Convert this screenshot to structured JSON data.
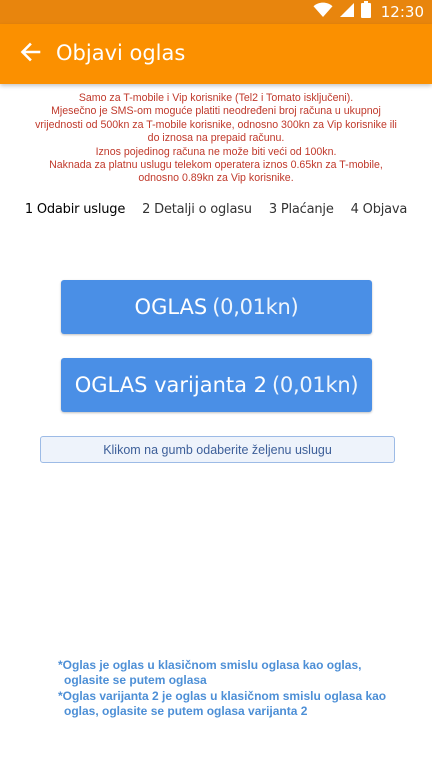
{
  "status_bar": {
    "time": "12:30",
    "icons": [
      "wifi-icon",
      "signal-icon",
      "battery-icon"
    ]
  },
  "app_bar": {
    "title": "Objavi oglas",
    "back_icon": "arrow-left-icon"
  },
  "notice": {
    "line1": "Samo za T-mobile i Vip korisnike (Tel2 i Tomato isključeni).",
    "line2": "Mjesečno je SMS-om moguće platiti neodređeni broj računa u ukupnoj vrijednosti od 500kn za T-mobile korisnike, odnosno 300kn za Vip korisnike ili do iznosa na prepaid računu.",
    "line3": "Iznos pojedinog računa ne može biti veći od 100kn.",
    "line4": "Naknada za platnu uslugu telekom operatera iznos 0.65kn za T-mobile, odnosno 0.89kn za Vip korisnike."
  },
  "steps": [
    {
      "label": "1 Odabir usluge"
    },
    {
      "label": "2 Detalji o oglasu"
    },
    {
      "label": "3 Plaćanje"
    },
    {
      "label": "4 Objava"
    }
  ],
  "buttons": {
    "oglas": {
      "name": "OGLAS",
      "price": "(0,01kn)"
    },
    "oglas_v2": {
      "name": "OGLAS varijanta 2",
      "price": "(0,01kn)"
    }
  },
  "hint": "Klikom na gumb odaberite željenu uslugu",
  "footnotes": {
    "f1_line1": "*Oglas je oglas u klasičnom smislu oglasa kao oglas,",
    "f1_line2": "oglasite se putem oglasa",
    "f2_line1": "*Oglas varijanta 2 je oglas u klasičnom smislu oglasa kao",
    "f2_line2": "oglas, oglasite se putem oglasa varijanta 2"
  },
  "colors": {
    "status_bar": "#e8850d",
    "app_bar": "#fb9000",
    "button": "#4a8fe6",
    "notice_text": "#c0392b",
    "footnote_text": "#4d8fd6"
  }
}
